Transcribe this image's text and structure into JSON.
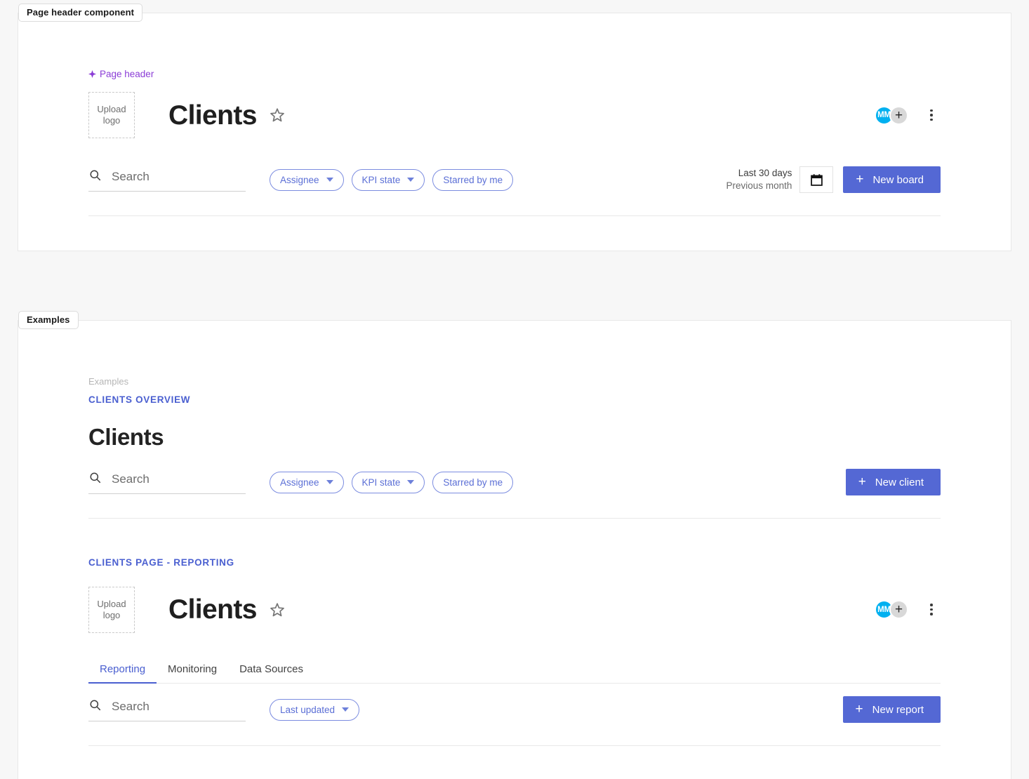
{
  "panels": {
    "header_component": {
      "badge": "Page header component"
    },
    "examples": {
      "badge": "Examples"
    }
  },
  "page_header": {
    "annotation_label": "Page header",
    "annotation_icon": "diamond-icon",
    "annotation_color": "#8b3dd6",
    "upload_logo_line1": "Upload",
    "upload_logo_line2": "logo",
    "title": "Clients",
    "star_icon": "star-outline-icon",
    "avatar_initials": "MM",
    "avatar_color": "#00b0f0",
    "add_user_label": "+",
    "more_menu_icon": "kebab-menu-icon",
    "toolbar": {
      "search_placeholder": "Search",
      "search_icon": "search-icon",
      "chips": [
        {
          "label": "Assignee",
          "has_caret": true
        },
        {
          "label": "KPI state",
          "has_caret": true
        },
        {
          "label": "Starred by me",
          "has_caret": false
        }
      ],
      "date_range_primary": "Last 30 days",
      "date_range_secondary": "Previous month",
      "calendar_icon": "calendar-icon",
      "primary_button": "New board",
      "primary_button_icon": "plus-icon",
      "primary_color": "#5468d4"
    }
  },
  "examples": {
    "clients_overview": {
      "breadcrumb": "Examples",
      "section_label": "CLIENTS OVERVIEW",
      "title": "Clients",
      "toolbar": {
        "search_placeholder": "Search",
        "search_icon": "search-icon",
        "chips": [
          {
            "label": "Assignee",
            "has_caret": true
          },
          {
            "label": "KPI state",
            "has_caret": true
          },
          {
            "label": "Starred by me",
            "has_caret": false
          }
        ],
        "primary_button": "New client",
        "primary_button_icon": "plus-icon"
      }
    },
    "clients_reporting": {
      "section_label": "CLIENTS PAGE - REPORTING",
      "upload_logo_line1": "Upload",
      "upload_logo_line2": "logo",
      "title": "Clients",
      "star_icon": "star-outline-icon",
      "avatar_initials": "MM",
      "add_user_label": "+",
      "more_menu_icon": "kebab-menu-icon",
      "tabs": [
        {
          "label": "Reporting",
          "active": true
        },
        {
          "label": "Monitoring",
          "active": false
        },
        {
          "label": "Data Sources",
          "active": false
        }
      ],
      "toolbar": {
        "search_placeholder": "Search",
        "search_icon": "search-icon",
        "chips": [
          {
            "label": "Last updated",
            "has_caret": true
          }
        ],
        "primary_button": "New report",
        "primary_button_icon": "plus-icon"
      }
    }
  }
}
